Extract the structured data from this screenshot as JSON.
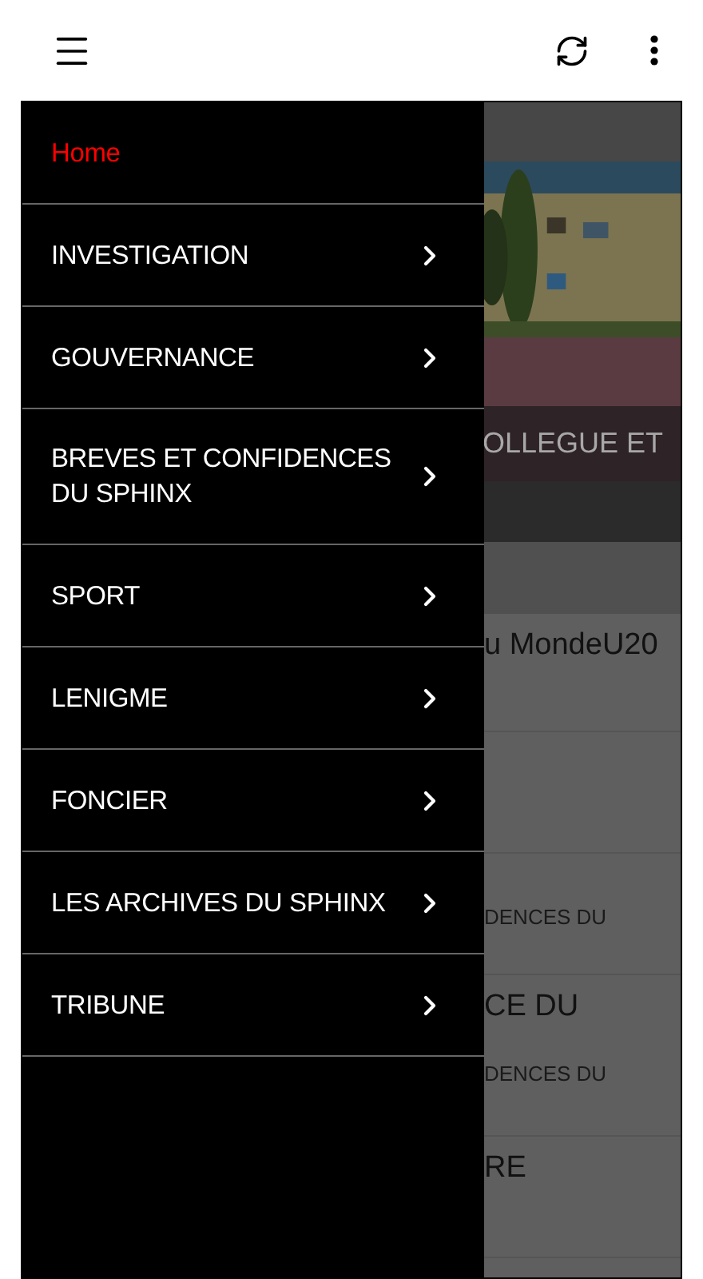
{
  "drawer": {
    "items": [
      {
        "label": "Home",
        "selected": true,
        "has_submenu": false
      },
      {
        "label": "INVESTIGATION",
        "selected": false,
        "has_submenu": true
      },
      {
        "label": "GOUVERNANCE",
        "selected": false,
        "has_submenu": true
      },
      {
        "label": "BREVES ET CONFIDENCES DU SPHINX",
        "selected": false,
        "has_submenu": true
      },
      {
        "label": "SPORT",
        "selected": false,
        "has_submenu": true
      },
      {
        "label": "LENIGME",
        "selected": false,
        "has_submenu": true
      },
      {
        "label": "FONCIER",
        "selected": false,
        "has_submenu": true
      },
      {
        "label": "LES ARCHIVES DU SPHINX",
        "selected": false,
        "has_submenu": true
      },
      {
        "label": "TRIBUNE",
        "selected": false,
        "has_submenu": true
      }
    ]
  },
  "content": {
    "feature": {
      "kind": "picture",
      "caption": "OLLEGUE ET"
    },
    "articles": [
      {
        "kind": "text",
        "title": "u MondeU20"
      },
      {
        "kind": "blank"
      },
      {
        "kind": "text",
        "category": "DENCES DU"
      },
      {
        "kind": "text",
        "title": "CE DU",
        "category": "DENCES DU"
      },
      {
        "kind": "text",
        "title": "RE"
      }
    ]
  }
}
